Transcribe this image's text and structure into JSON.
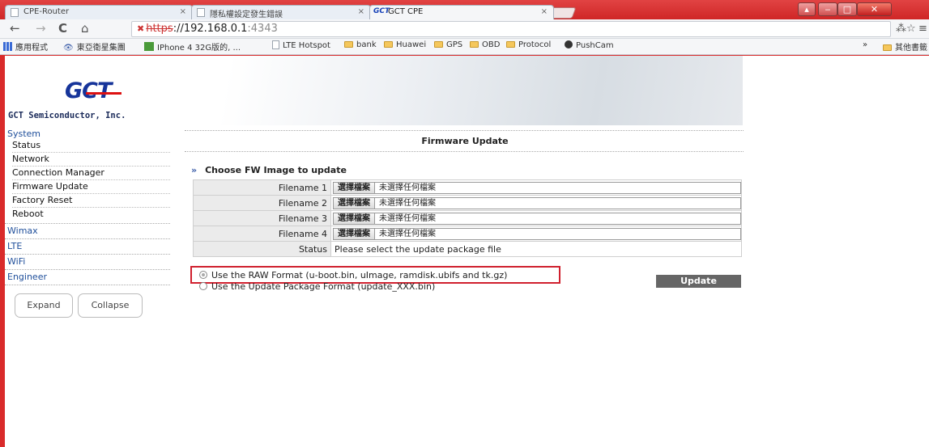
{
  "browser": {
    "tabs": [
      {
        "label": "CPE-Router"
      },
      {
        "label": "隱私權設定發生錯誤"
      },
      {
        "label": "GCT CPE",
        "icon_text": "GCT"
      }
    ],
    "close_glyph": "×",
    "address": {
      "scheme": "https",
      "rest": "://192.168.0.1",
      "port": ":4343"
    },
    "window_buttons": {
      "restore": "▴",
      "minimize": "‒",
      "maximize": "□",
      "close": "✕"
    },
    "nav": {
      "back": "←",
      "forward": "→",
      "reload": "C",
      "home": "⌂"
    },
    "right_icons": {
      "translate": "⁂",
      "star": "☆",
      "menu": "≡"
    },
    "bookmarks": [
      {
        "label": "應用程式",
        "icon": "apps-icon"
      },
      {
        "label": "東亞衛星集團",
        "icon": "eye-icon"
      },
      {
        "label": "IPhone 4 32G版的, ...",
        "icon": "green-icon"
      },
      {
        "label": "LTE Hotspot",
        "icon": "page-icon"
      },
      {
        "label": "bank",
        "icon": "folder-icon"
      },
      {
        "label": "Huawei",
        "icon": "folder-icon"
      },
      {
        "label": "GPS",
        "icon": "folder-icon"
      },
      {
        "label": "OBD",
        "icon": "folder-icon"
      },
      {
        "label": "Protocol",
        "icon": "folder-icon"
      },
      {
        "label": "PushCam",
        "icon": "dot-icon"
      }
    ],
    "bookmarks_more": "»",
    "other_bookmarks": "其他書籤"
  },
  "header": {
    "logo_text": "GCT",
    "company": "GCT Semiconductor, Inc."
  },
  "sidebar": {
    "groups": [
      {
        "title": "System",
        "items": [
          "Status",
          "Network",
          "Connection Manager",
          "Firmware Update",
          "Factory Reset",
          "Reboot"
        ]
      },
      {
        "title": "Wimax",
        "items": []
      },
      {
        "title": "LTE",
        "items": []
      },
      {
        "title": "WiFi",
        "items": []
      },
      {
        "title": "Engineer",
        "items": []
      }
    ],
    "expand_label": "Expand",
    "collapse_label": "Collapse"
  },
  "main": {
    "title": "Firmware Update",
    "section_marker": "»",
    "section_heading": "Choose FW Image to update",
    "rows": [
      {
        "label": "Filename 1",
        "button": "選擇檔案",
        "value": "未選擇任何檔案"
      },
      {
        "label": "Filename 2",
        "button": "選擇檔案",
        "value": "未選擇任何檔案"
      },
      {
        "label": "Filename 3",
        "button": "選擇檔案",
        "value": "未選擇任何檔案"
      },
      {
        "label": "Filename 4",
        "button": "選擇檔案",
        "value": "未選擇任何檔案"
      }
    ],
    "status_label": "Status",
    "status_value": "Please select the update package file",
    "option_raw": "Use the RAW Format (u-boot.bin, uImage, ramdisk.ubifs and tk.gz)",
    "option_package": "Use the Update Package Format (update_XXX.bin)",
    "update_label": "Update"
  }
}
